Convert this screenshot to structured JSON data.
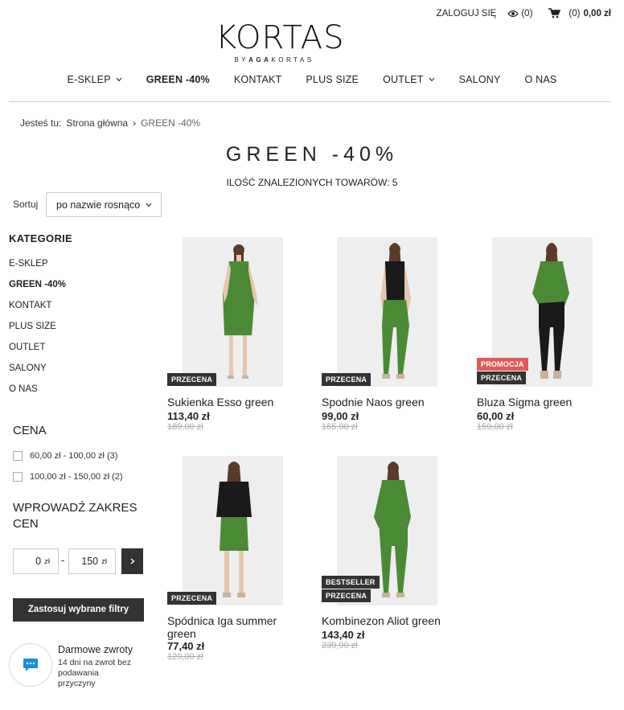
{
  "header": {
    "login": "ZALOGUJ SIĘ",
    "viewed": "(0)",
    "cart_count": "(0)",
    "cart_total": "0,00 zł",
    "logo_main": "KORTAS",
    "logo_sub_by": "BY",
    "logo_sub_name": "AGA",
    "logo_sub_last": "KORTAS"
  },
  "nav": {
    "items": [
      "E-SKLEP",
      "GREEN -40%",
      "KONTAKT",
      "PLUS SIZE",
      "OUTLET",
      "SALONY",
      "O NAS"
    ]
  },
  "breadcrumb": {
    "prefix": "Jesteś tu:",
    "home": "Strona główna",
    "separator": "›",
    "current": "GREEN -40%"
  },
  "page": {
    "title": "GREEN -40%",
    "count": "ILOŚĆ ZNALEZIONYCH TOWARÓW: 5",
    "sort_label": "Sortuj",
    "sort_value": "po nazwie rosnąco"
  },
  "sidebar": {
    "title": "KATEGORIE",
    "categories": [
      "E-SKLEP",
      "GREEN -40%",
      "KONTAKT",
      "PLUS SIZE",
      "OUTLET",
      "SALONY",
      "O NAS"
    ],
    "price_title": "CENA",
    "price_options": [
      "60,00 zł - 100,00 zł (3)",
      "100,00 zł - 150,00 zł (2)"
    ],
    "range_title": "WPROWADŹ ZAKRES CEN",
    "range_min": "0",
    "range_max": "150",
    "range_unit": "zł",
    "range_dash": "-",
    "apply": "Zastosuj wybrane filtry"
  },
  "returns": {
    "title": "Darmowe zwroty",
    "text": "14 dni na zwrot bez podawania przyczyny"
  },
  "products": [
    {
      "name": "Sukienka Esso green",
      "price": "113,40 zł",
      "old_price": "189,00 zł",
      "badges": [
        "PRZECENA"
      ]
    },
    {
      "name": "Spodnie Naos green",
      "price": "99,00 zł",
      "old_price": "165,00 zł",
      "badges": [
        "PRZECENA"
      ]
    },
    {
      "name": "Bluza Sigma green",
      "price": "60,00 zł",
      "old_price": "159,00 zł",
      "badges": [
        "PROMOCJA",
        "PRZECENA"
      ]
    },
    {
      "name": "Spódnica Iga summer green",
      "price": "77,40 zł",
      "old_price": "129,00 zł",
      "badges": [
        "PRZECENA"
      ]
    },
    {
      "name": "Kombinezon Aliot green",
      "price": "143,40 zł",
      "old_price": "239,00 zł",
      "badges": [
        "BESTSELLER",
        "PRZECENA"
      ]
    }
  ],
  "colors": {
    "dark": "#333333",
    "promo": "#e05a5a",
    "green": "#4a8a35",
    "black": "#1a1a1a"
  }
}
